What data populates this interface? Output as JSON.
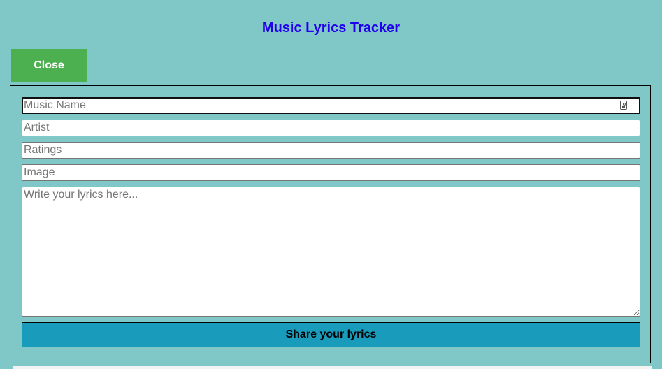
{
  "header": {
    "title": "Music Lyrics Tracker"
  },
  "close_button": {
    "label": "Close"
  },
  "form": {
    "music_name": {
      "value": "",
      "placeholder": "Music Name"
    },
    "artist": {
      "value": "",
      "placeholder": "Artist"
    },
    "ratings": {
      "value": "",
      "placeholder": "Ratings"
    },
    "image": {
      "value": "",
      "placeholder": "Image"
    },
    "lyrics": {
      "value": "",
      "placeholder": "Write your lyrics here..."
    },
    "submit_label": "Share your lyrics"
  },
  "icons": {
    "autofill": "contact-card-icon"
  },
  "colors": {
    "background": "#80c8c8",
    "title": "#2200ee",
    "close_button": "#4cb050",
    "share_button": "#199bbb"
  }
}
